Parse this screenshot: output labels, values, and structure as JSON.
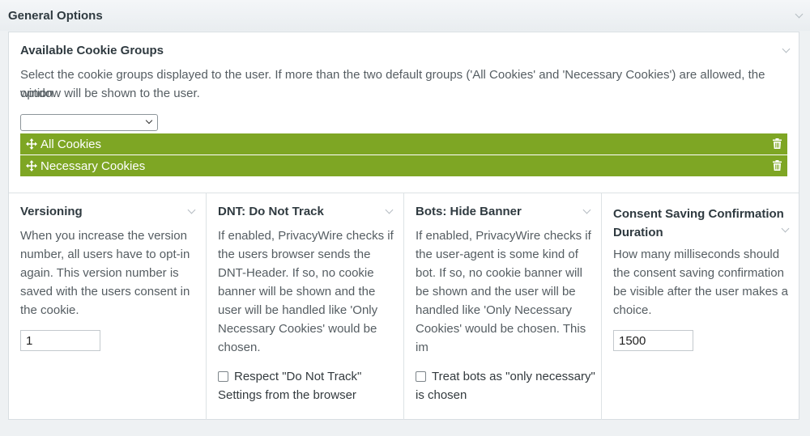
{
  "section": {
    "title": "General Options"
  },
  "cookie_groups": {
    "title": "Available Cookie Groups",
    "description_line1": "Select the cookie groups displayed to the user. If more than the two default groups ('All Cookies' and 'Necessary Cookies') are allowed, the option",
    "description_line2": "window will be shown to the user.",
    "select_value": "",
    "items": [
      {
        "label": "All Cookies"
      },
      {
        "label": "Necessary Cookies"
      }
    ],
    "accent_color": "#7ea624"
  },
  "versioning": {
    "title": "Versioning",
    "lines": [
      "When you increase the version",
      "number, all users have to opt-in",
      "again. This version number is",
      "saved with the users consent in",
      "the cookie."
    ],
    "value": "1"
  },
  "dnt": {
    "title": "DNT: Do Not Track",
    "lines": [
      "If enabled, PrivacyWire checks if",
      "the users browser sends the",
      "DNT-Header. If so, no cookie",
      "banner will be shown and the",
      "user will be handled like 'Only",
      "Necessary Cookies' would be",
      "chosen."
    ],
    "checkbox_line1": "Respect \"Do Not Track\"",
    "checkbox_line2": "Settings from the browser",
    "checked": false
  },
  "bots": {
    "title": "Bots: Hide Banner",
    "lines": [
      "If enabled, PrivacyWire checks if",
      "the user-agent is some kind of",
      "bot. If so, no cookie banner will",
      "be shown and the user will be",
      "handled like 'Only Necessary",
      "Cookies' would be chosen. This",
      "im"
    ],
    "checkbox_line1": "Treat bots as \"only necessary\"",
    "checkbox_line2": "is chosen",
    "checked": false
  },
  "consent_duration": {
    "title_line1": "Consent Saving Confirmation",
    "title_line2": "Duration",
    "lines": [
      "How many milliseconds should",
      "the consent saving confirmation",
      "be visible after the user makes a",
      "choice."
    ],
    "value": "1500"
  }
}
